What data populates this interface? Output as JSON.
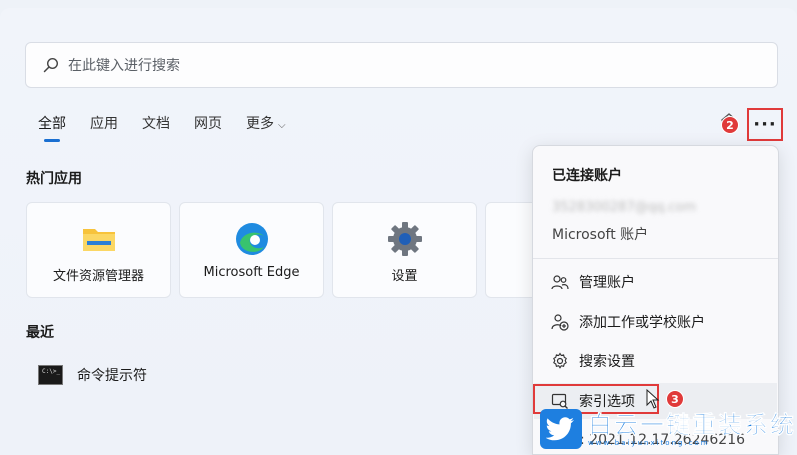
{
  "search": {
    "placeholder": "在此键入进行搜索"
  },
  "tabs": [
    {
      "label": "全部",
      "active": true
    },
    {
      "label": "应用"
    },
    {
      "label": "文档"
    },
    {
      "label": "网页"
    },
    {
      "label": "更多"
    }
  ],
  "toolbar": {
    "more_label": "···",
    "badge_more": "2"
  },
  "hot_apps": {
    "title": "热门应用",
    "items": [
      {
        "label": "文件资源管理器",
        "icon": "folder-icon"
      },
      {
        "label": "Microsoft Edge",
        "icon": "edge-icon"
      },
      {
        "label": "设置",
        "icon": "gear-icon"
      }
    ]
  },
  "recent": {
    "title": "最近",
    "items": [
      {
        "label": "命令提示符",
        "icon": "cmd-icon"
      }
    ]
  },
  "menu": {
    "header": "已连接账户",
    "email": "3528300287@qq.com",
    "account_type": "Microsoft 账户",
    "items": [
      {
        "label": "管理账户",
        "icon": "people-icon"
      },
      {
        "label": "添加工作或学校账户",
        "icon": "add-person-icon"
      },
      {
        "label": "搜索设置",
        "icon": "gear-icon"
      },
      {
        "label": "索引选项",
        "icon": "index-search-icon",
        "highlighted": true
      }
    ],
    "badge_index": "3",
    "version": "版本: 2021.12.17.26246216"
  },
  "watermark": {
    "cn": "白云一键重装系统",
    "en": "www.baiyunxitong.com"
  },
  "colors": {
    "accent": "#1a6fd1",
    "highlight_red": "#e03a3a"
  }
}
